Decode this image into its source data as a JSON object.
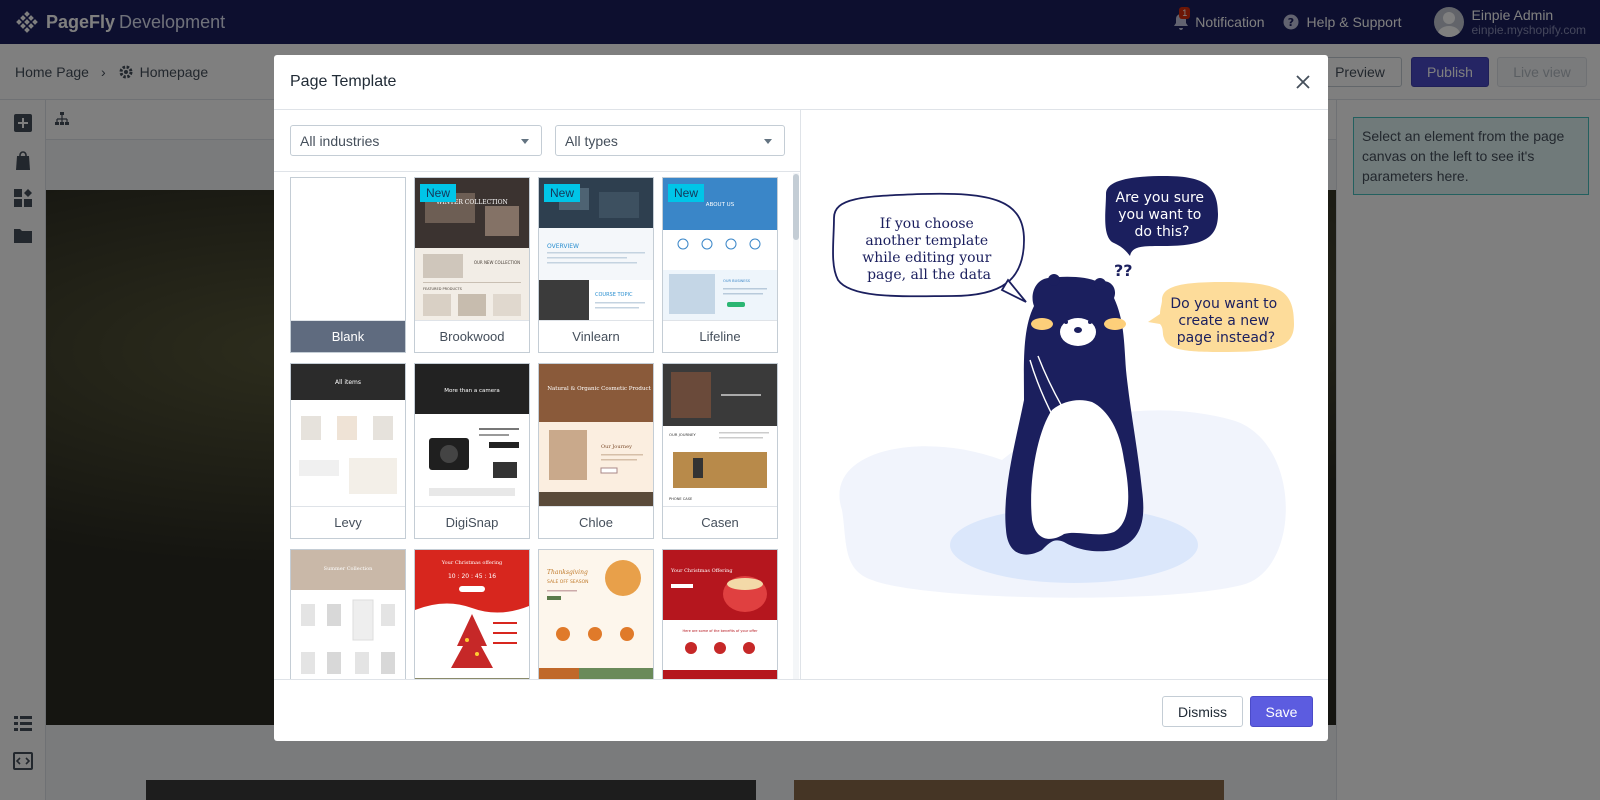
{
  "app": {
    "logo_brand": "PageFly",
    "logo_env": "Development",
    "notification_label": "Notification",
    "notification_count": "1",
    "help_label": "Help & Support",
    "user_name": "Einpie Admin",
    "user_store": "einpie.myshopify.com"
  },
  "breadcrumb": {
    "home": "Home Page",
    "current": "Homepage"
  },
  "toolbar": {
    "preview": "Preview",
    "publish": "Publish",
    "live_view": "Live view"
  },
  "right_panel": {
    "hint": "Select an element from the page canvas on the left to see it's parameters here."
  },
  "modal": {
    "title": "Page Template",
    "filters": {
      "industry": "All industries",
      "type": "All types"
    },
    "templates": [
      {
        "name": "Blank",
        "new": false
      },
      {
        "name": "Brookwood",
        "new": true,
        "new_label": "New"
      },
      {
        "name": "Vinlearn",
        "new": true,
        "new_label": "New"
      },
      {
        "name": "Lifeline",
        "new": true,
        "new_label": "New"
      },
      {
        "name": "Levy",
        "new": false
      },
      {
        "name": "DigiSnap",
        "new": false
      },
      {
        "name": "Chloe",
        "new": false
      },
      {
        "name": "Casen",
        "new": false
      },
      {
        "name": "",
        "new": false
      },
      {
        "name": "",
        "new": false
      },
      {
        "name": "",
        "new": false
      },
      {
        "name": "",
        "new": false
      }
    ],
    "thumb_text": {
      "brookwood_hero": "WINTER COLLECTION",
      "brookwood_sub": "OUR NEW COLLECTION",
      "brookwood_feat": "FEATURED PRODUCTS",
      "vinlearn_overview": "OVERVIEW",
      "vinlearn_topic": "COURSE TOPIC",
      "lifeline_about": "ABOUT US",
      "lifeline_business": "OUR BUSINESS",
      "levy_hero": "All items",
      "digisnap_hero": "More than a camera",
      "chloe_hero": "Natural & Organic Cosmetic Product",
      "chloe_journey": "Our Journey",
      "casen_journey": "OUR JOURNEY",
      "casen_case": "PHONE CASE",
      "summer_hero": "Summer Collection",
      "xmas_hero": "Your Christmas offering",
      "xmas_count": "10 : 20 : 45 : 16",
      "thanks_title": "Thanksgiving",
      "thanks_sub": "SALE OFF SEASON",
      "xmas2_title": "Your Christmas Offering",
      "xmas2_benefits": "Here are some of the benefits of your offer"
    },
    "illustration": {
      "bubble_left": "If you choose another template while editing your page, all the data will be gone!",
      "bubble_top": "Are you sure you want to do this?",
      "bubble_right": "Do you want to create a new page instead?",
      "question_marks": "??"
    },
    "dismiss": "Dismiss",
    "save": "Save"
  },
  "colors": {
    "topbar": "#1b1f5e",
    "primary": "#5c5ce0",
    "bear": "#1b1f5e",
    "bubble_dark": "#1b1f5e",
    "bubble_yellow": "#fddc9a",
    "new_tag": "#00c5e8"
  },
  "icons": [
    "pagefly-logo-icon",
    "bell-icon",
    "help-icon",
    "avatar",
    "gear-icon",
    "chevron-right-icon",
    "plus-icon",
    "shopify-bag-icon",
    "apps-icon",
    "folder-icon",
    "sitemap-icon",
    "layers-icon",
    "code-icon",
    "close-icon",
    "caret-down-icon"
  ]
}
